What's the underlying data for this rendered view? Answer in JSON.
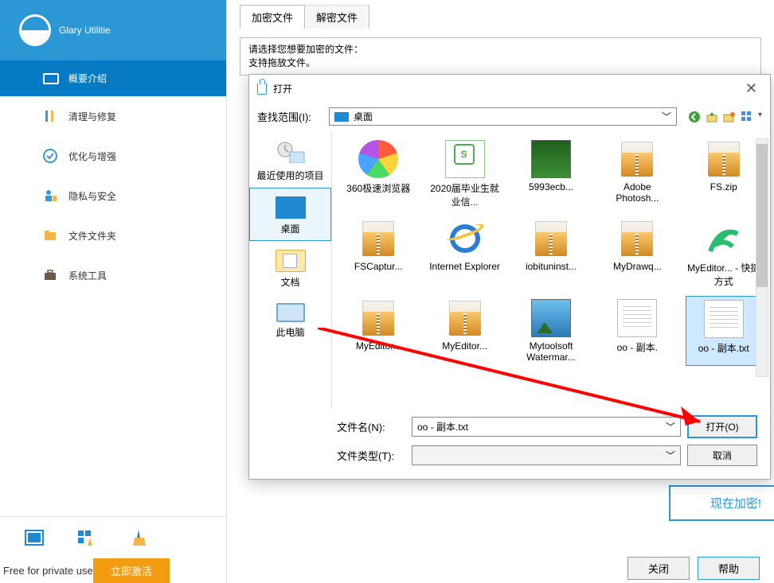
{
  "logo_text": "Glary Utilitie",
  "nav_header": "概要介绍",
  "nav": {
    "clean": "清理与修复",
    "optimize": "优化与增强",
    "privacy": "隐私与安全",
    "files": "文件文件夹",
    "tools": "系统工具"
  },
  "license_text": "Free for private use",
  "license_btn": "立即激活",
  "tabs": {
    "encrypt": "加密文件",
    "decrypt": "解密文件"
  },
  "instruction_line1": "请选择您想要加密的文件：",
  "instruction_line2": "支持拖放文件。",
  "encrypt_now": "现在加密!",
  "footer": {
    "close": "关闭",
    "help": "帮助"
  },
  "dialog": {
    "title": "打开",
    "lookup_label": "查找范围(I):",
    "lookup_value": "桌面",
    "places": {
      "recent": "最近使用的项目",
      "desktop": "桌面",
      "docs": "文档",
      "pc": "此电脑"
    },
    "files": [
      {
        "name": "360极速浏览器",
        "type": "browser"
      },
      {
        "name": "2020届毕业生就业信...",
        "type": "doc"
      },
      {
        "name": "5993ecb...",
        "type": "pic"
      },
      {
        "name": "Adobe Photosh...",
        "type": "zip"
      },
      {
        "name": "FS.zip",
        "type": "zip"
      },
      {
        "name": "FSCaptur...",
        "type": "zip"
      },
      {
        "name": "Internet Explorer",
        "type": "ie"
      },
      {
        "name": "iobituninst...",
        "type": "zip"
      },
      {
        "name": "MyDrawq...",
        "type": "zip"
      },
      {
        "name": "MyEditor... - 快捷方式",
        "type": "app"
      },
      {
        "name": "MyEditor...",
        "type": "zip"
      },
      {
        "name": "MyEditor...",
        "type": "zip"
      },
      {
        "name": "Mytoolsoft Watermar...",
        "type": "pic2"
      },
      {
        "name": "oo - 副本.",
        "type": "txt"
      },
      {
        "name": "oo - 副本.txt",
        "type": "txt",
        "selected": true
      }
    ],
    "filename_label": "文件名(N):",
    "filename_value": "oo - 副本.txt",
    "filetype_label": "文件类型(T):",
    "filetype_value": "",
    "open_btn": "打开(O)",
    "cancel_btn": "取消"
  }
}
